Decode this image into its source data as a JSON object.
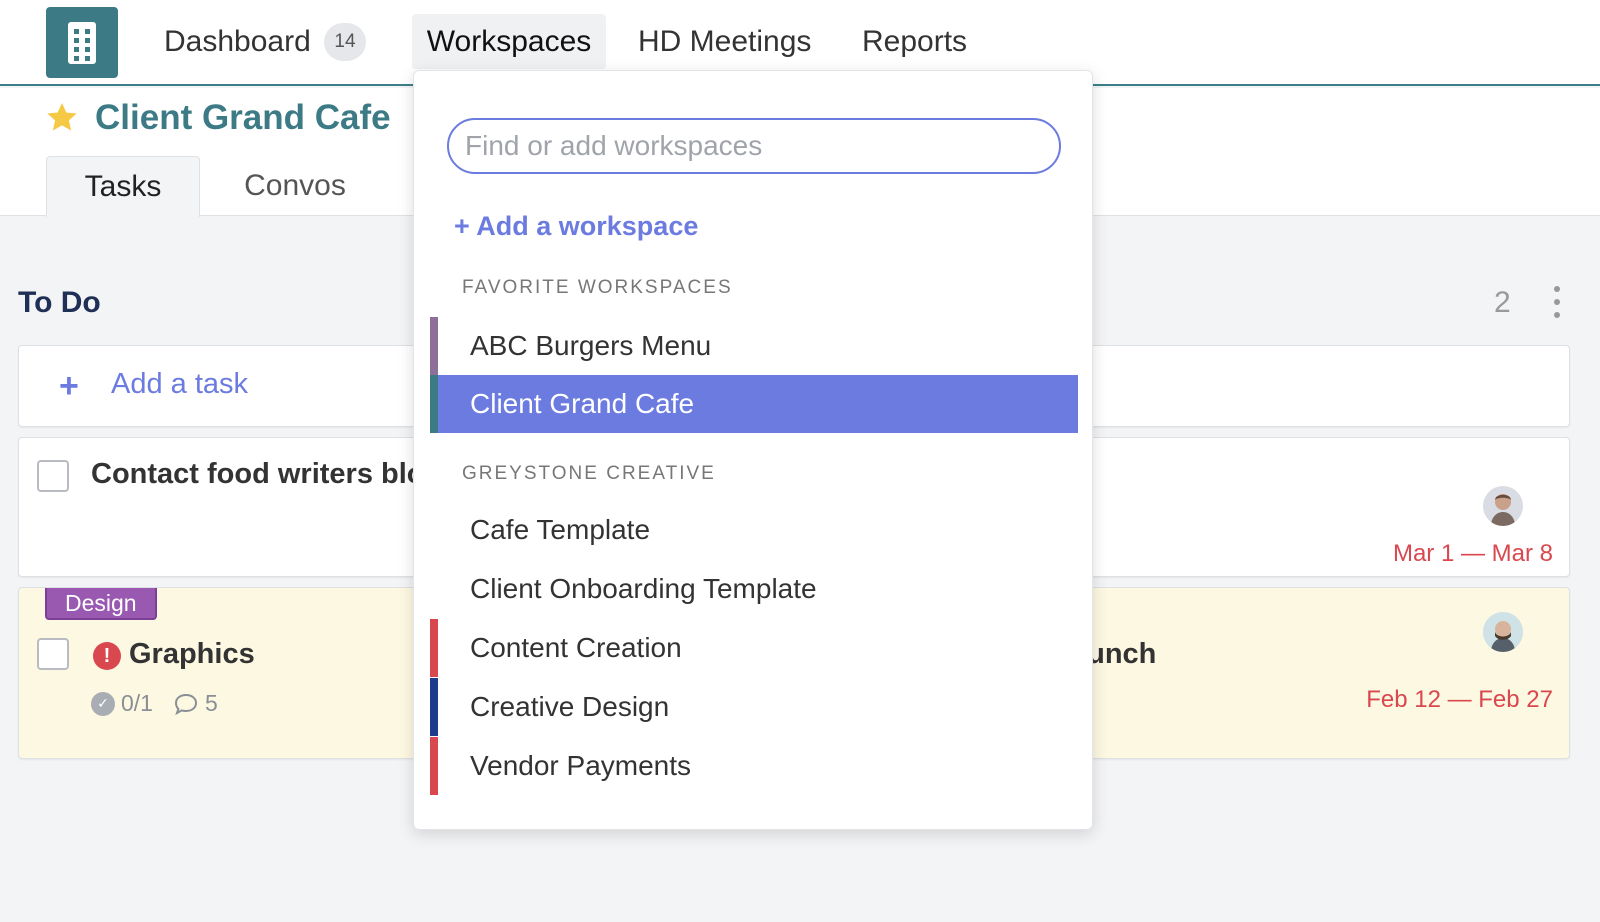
{
  "nav": {
    "logo_icon": "building-icon",
    "dashboard": "Dashboard",
    "dashboard_badge": "14",
    "workspaces": "Workspaces",
    "hd_meetings": "HD Meetings",
    "reports": "Reports"
  },
  "header": {
    "favorite_icon": "star-icon",
    "title": "Client Grand Cafe",
    "tabs": [
      {
        "label": "Tasks",
        "active": true
      },
      {
        "label": "Convos",
        "active": false
      }
    ]
  },
  "board": {
    "column_title": "To Do",
    "column_count": "2",
    "add_task": "Add a task",
    "tasks": [
      {
        "title": "Contact food writers blog",
        "date": "Mar 1 — Mar 8"
      },
      {
        "tag": "Design",
        "title": "Graphics",
        "title_right_fragment": "aunch",
        "subtasks": "0/1",
        "comments": "5",
        "date": "Feb 12 — Feb 27"
      }
    ]
  },
  "dropdown": {
    "search_placeholder": "Find or add workspaces",
    "add_workspace": "+ Add a workspace",
    "favorites_label": "FAVORITE WORKSPACES",
    "favorites": [
      {
        "label": "ABC Burgers Menu",
        "color": "#8e6f9a",
        "selected": false
      },
      {
        "label": "Client Grand Cafe",
        "color": "#3c7b85",
        "selected": true
      }
    ],
    "group_label": "GREYSTONE CREATIVE",
    "group_items": [
      {
        "label": "Cafe Template",
        "color": ""
      },
      {
        "label": "Client Onboarding Template",
        "color": ""
      },
      {
        "label": "Content Creation",
        "color": "#d9474f"
      },
      {
        "label": "Creative Design",
        "color": "#1f3b8c"
      },
      {
        "label": "Vendor Payments",
        "color": "#d9474f"
      }
    ]
  },
  "colors": {
    "brand": "#3c7b85",
    "accent": "#6b7be0",
    "danger": "#d9474f"
  }
}
